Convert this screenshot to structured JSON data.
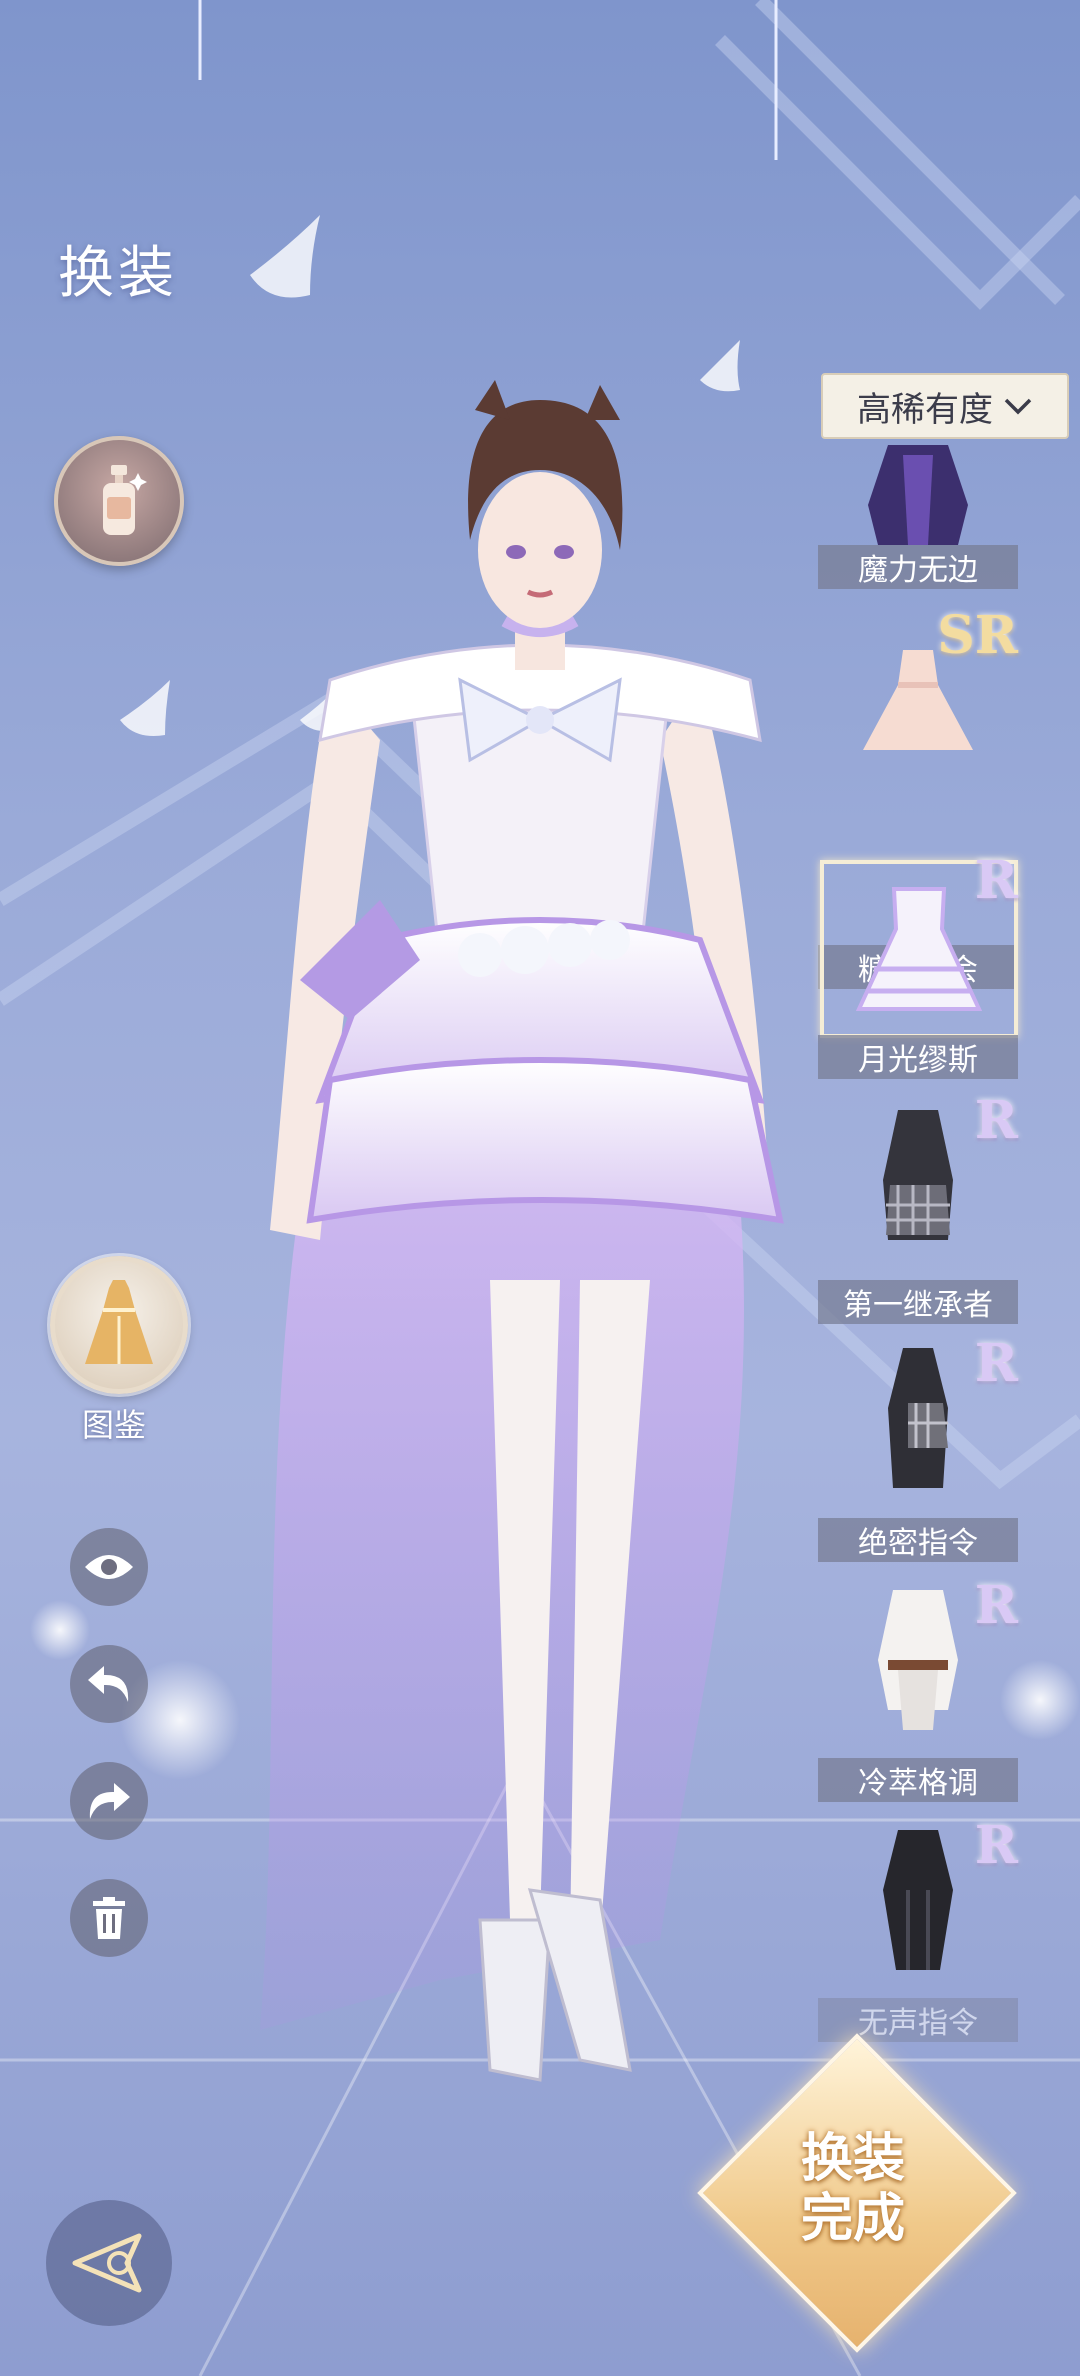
{
  "header": {
    "title": "换装"
  },
  "left_panel": {
    "lotion_icon": "lotion-bottle-icon",
    "atlas_icon": "dress-icon",
    "atlas_label": "图鉴",
    "tools": [
      "eye-icon",
      "undo-icon",
      "redo-icon",
      "trash-icon"
    ]
  },
  "filter": {
    "label": "高稀有度",
    "icon": "chevron-down-icon"
  },
  "outfits": [
    {
      "name": "魔力无边",
      "rarity": ""
    },
    {
      "name": "糖霜舞会",
      "rarity": "SR"
    },
    {
      "name": "月光缪斯",
      "rarity": "R",
      "selected": true
    },
    {
      "name": "第一继承者",
      "rarity": "R"
    },
    {
      "name": "绝密指令",
      "rarity": "R"
    },
    {
      "name": "冷萃格调",
      "rarity": "R"
    },
    {
      "name": "无声指令",
      "rarity": "R"
    }
  ],
  "finish": {
    "line1": "换装",
    "line2": "完成"
  },
  "back_icon": "back-arrow-icon",
  "colors": {
    "bg": "#9aaad8",
    "gold": "#f0c98a",
    "lilac": "#c9b3ef"
  }
}
